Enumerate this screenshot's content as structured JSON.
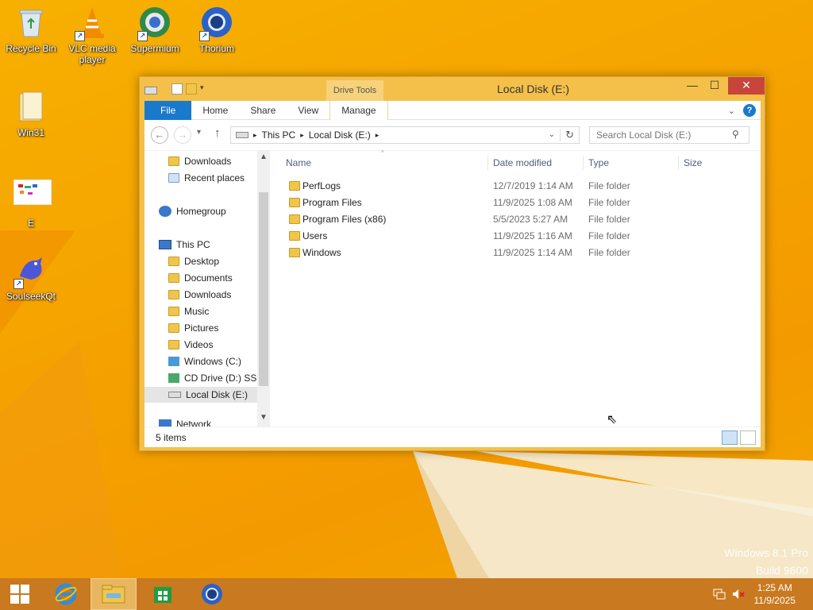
{
  "desktop": {
    "icons": [
      {
        "label": "Recycle Bin"
      },
      {
        "label": "VLC media player"
      },
      {
        "label": "Supermium"
      },
      {
        "label": "Thorium"
      },
      {
        "label": "Win31"
      },
      {
        "label": "E"
      },
      {
        "label": "SoulseekQt"
      }
    ],
    "watermark_line1": "Windows 8.1 Pro",
    "watermark_line2": "Build 9600"
  },
  "window": {
    "title": "Local Disk (E:)",
    "contextual_tab": "Drive Tools",
    "ribbon_tabs": [
      "File",
      "Home",
      "Share",
      "View",
      "Manage"
    ],
    "address": {
      "segments": [
        "This PC",
        "Local Disk (E:)"
      ]
    },
    "search_placeholder": "Search Local Disk (E:)",
    "nav_pane": {
      "items": [
        {
          "label": "Downloads"
        },
        {
          "label": "Recent places"
        },
        {
          "label": "Homegroup"
        },
        {
          "label": "This PC"
        },
        {
          "label": "Desktop"
        },
        {
          "label": "Documents"
        },
        {
          "label": "Downloads"
        },
        {
          "label": "Music"
        },
        {
          "label": "Pictures"
        },
        {
          "label": "Videos"
        },
        {
          "label": "Windows (C:)"
        },
        {
          "label": "CD Drive (D:) SSS"
        },
        {
          "label": "Local Disk (E:)"
        },
        {
          "label": "Network"
        }
      ]
    },
    "columns": [
      "Name",
      "Date modified",
      "Type",
      "Size"
    ],
    "files": [
      {
        "name": "PerfLogs",
        "date": "12/7/2019 1:14 AM",
        "type": "File folder"
      },
      {
        "name": "Program Files",
        "date": "11/9/2025 1:08 AM",
        "type": "File folder"
      },
      {
        "name": "Program Files (x86)",
        "date": "5/5/2023 5:27 AM",
        "type": "File folder"
      },
      {
        "name": "Users",
        "date": "11/9/2025 1:16 AM",
        "type": "File folder"
      },
      {
        "name": "Windows",
        "date": "11/9/2025 1:14 AM",
        "type": "File folder"
      }
    ],
    "status": "5 items"
  },
  "taskbar": {
    "time": "1:25 AM",
    "date": "11/9/2025"
  },
  "colors": {
    "accent": "#1979ca",
    "close_button": "#c7453b",
    "window_frame": "#f4c04a",
    "taskbar": "#c9791f"
  }
}
